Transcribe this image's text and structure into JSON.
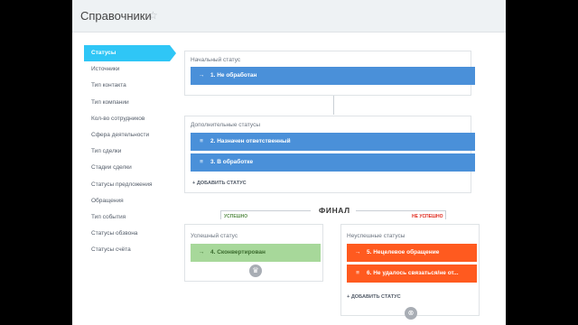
{
  "header": {
    "title": "Справочники",
    "star_icon": "star-outline-icon"
  },
  "sidebar": {
    "items": [
      {
        "label": "Статусы",
        "active": true
      },
      {
        "label": "Источники"
      },
      {
        "label": "Тип контакта"
      },
      {
        "label": "Тип компании"
      },
      {
        "label": "Кол-во сотрудников"
      },
      {
        "label": "Сфера деятельности"
      },
      {
        "label": "Тип сделки"
      },
      {
        "label": "Стадии сделки"
      },
      {
        "label": "Статусы предложения"
      },
      {
        "label": "Обращения"
      },
      {
        "label": "Тип события"
      },
      {
        "label": "Статусы обзвона"
      },
      {
        "label": "Статусы счёта"
      }
    ]
  },
  "initial": {
    "title": "Начальный статус",
    "status": "1. Не обработан",
    "icon": "→"
  },
  "additional": {
    "title": "Дополнительные статусы",
    "statuses": [
      {
        "label": "2. Назначен ответственный",
        "icon": "≡"
      },
      {
        "label": "3. В обработке",
        "icon": "≡"
      }
    ],
    "add_label": "+ ДОБАВИТЬ СТАТУС"
  },
  "final": {
    "title": "ФИНАЛ",
    "success_tag": "УСПЕШНО",
    "fail_tag": "НЕ УСПЕШНО"
  },
  "success": {
    "title": "Успешный статус",
    "status": "4. Сконвертирован",
    "icon": "→"
  },
  "fail": {
    "title": "Неуспешные статусы",
    "statuses": [
      {
        "label": "5. Нецелевое обращение",
        "icon": "→"
      },
      {
        "label": "6. Не удалось связаться/не от...",
        "icon": "≡"
      }
    ],
    "add_label": "+ ДОБАВИТЬ СТАТУС"
  },
  "colors": {
    "accent": "#2fc6f6",
    "status_blue": "#4a90d9",
    "success_green": "#a7d89a",
    "fail_orange": "#ff5a1f"
  }
}
